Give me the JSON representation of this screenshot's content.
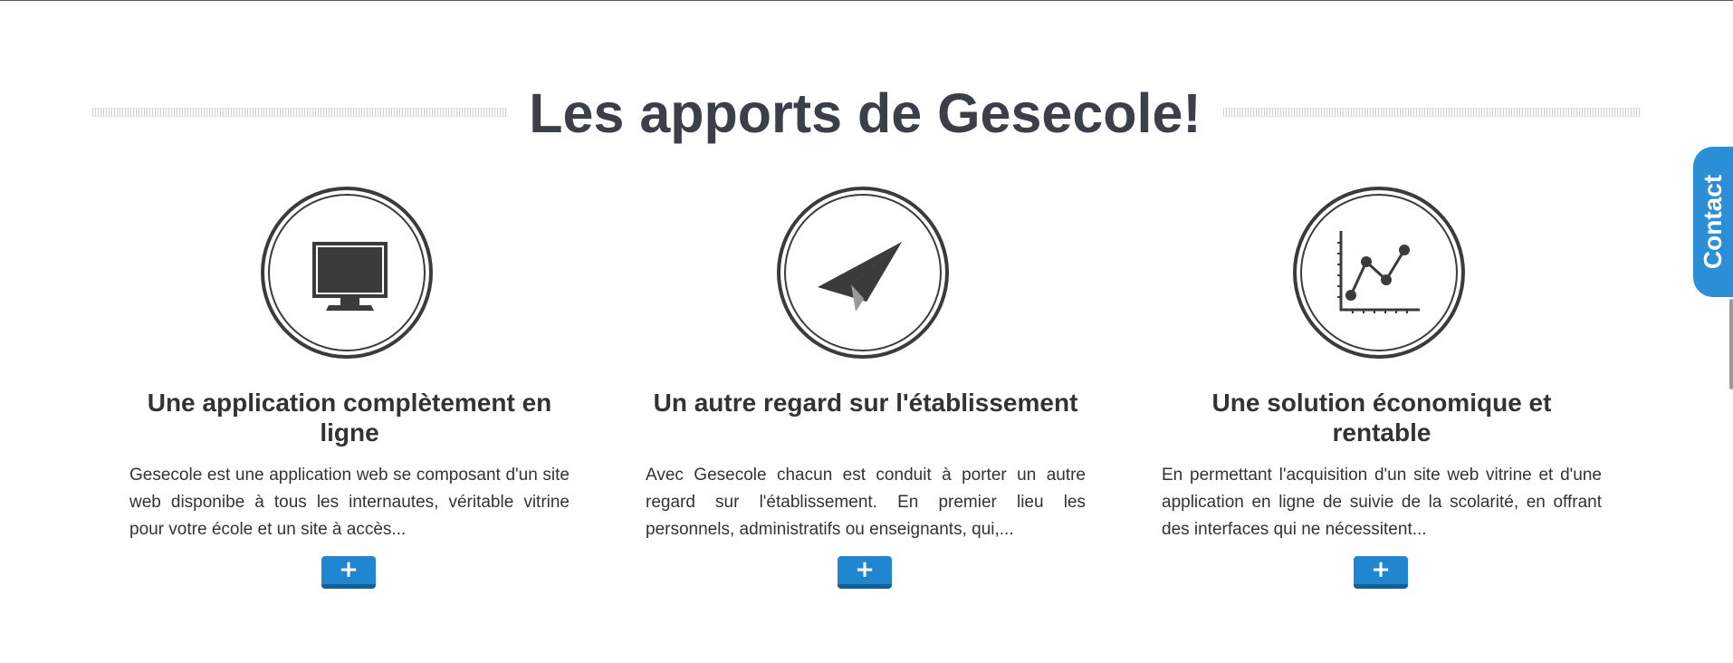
{
  "page_title": "Les apports de Gesecole!",
  "contact_label": "Contact",
  "features": [
    {
      "title": "Une application complètement en ligne",
      "text": "Gesecole est une application web se composant d'un site web disponibe à tous les internautes, véritable vitrine pour votre école et un site à accès...",
      "icon": "monitor-icon",
      "button_label": "+"
    },
    {
      "title": "Un autre regard sur l'établissement",
      "text": "Avec Gesecole chacun est conduit à porter un autre regard sur l'établissement. En premier lieu les personnels, administratifs ou enseignants, qui,...",
      "icon": "paper-plane-icon",
      "button_label": "+"
    },
    {
      "title": "Une solution économique et rentable",
      "text": "En permettant l'acquisition d'un site web vitrine et d'une application en ligne de suivie de la scolarité, en offrant des interfaces qui ne nécessitent...",
      "icon": "line-chart-icon",
      "button_label": "+"
    }
  ],
  "colors": {
    "accent": "#1f86cf",
    "contact_tab": "#2a8fd6",
    "title": "#3a3f48",
    "icon": "#3b3b3b"
  }
}
